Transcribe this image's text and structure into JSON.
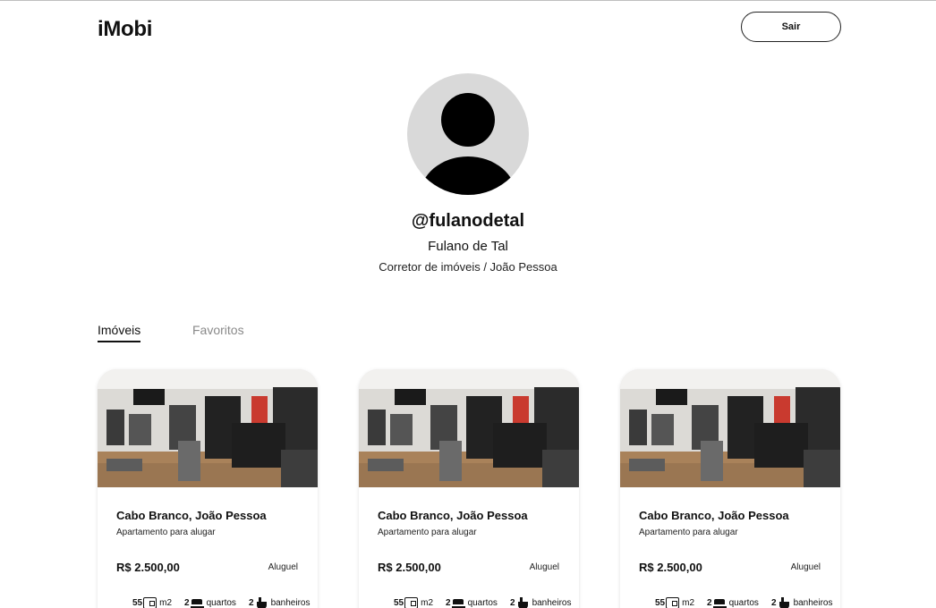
{
  "header": {
    "logo": "iMobi",
    "logout_label": "Sair"
  },
  "profile": {
    "username": "@fulanodetal",
    "name": "Fulano de Tal",
    "role": "Corretor de imóveis / João Pessoa"
  },
  "tabs": [
    {
      "label": "Imóveis",
      "active": true
    },
    {
      "label": "Favoritos",
      "active": false
    }
  ],
  "cards": [
    {
      "title": "Cabo Branco, João Pessoa",
      "subtitle": "Apartamento para alugar",
      "price": "R$ 2.500,00",
      "type": "Aluguel",
      "area_value": "55",
      "area_unit": "m2",
      "rooms_value": "2",
      "rooms_label": "quartos",
      "baths_value": "2",
      "baths_label": "banheiros"
    },
    {
      "title": "Cabo Branco, João Pessoa",
      "subtitle": "Apartamento para alugar",
      "price": "R$ 2.500,00",
      "type": "Aluguel",
      "area_value": "55",
      "area_unit": "m2",
      "rooms_value": "2",
      "rooms_label": "quartos",
      "baths_value": "2",
      "baths_label": "banheiros"
    },
    {
      "title": "Cabo Branco, João Pessoa",
      "subtitle": "Apartamento para alugar",
      "price": "R$ 2.500,00",
      "type": "Aluguel",
      "area_value": "55",
      "area_unit": "m2",
      "rooms_value": "2",
      "rooms_label": "quartos",
      "baths_value": "2",
      "baths_label": "banheiros"
    }
  ],
  "icons": {
    "area": "area-icon",
    "rooms": "bed-icon",
    "baths": "bathtub-icon",
    "avatar": "user-silhouette-icon"
  }
}
